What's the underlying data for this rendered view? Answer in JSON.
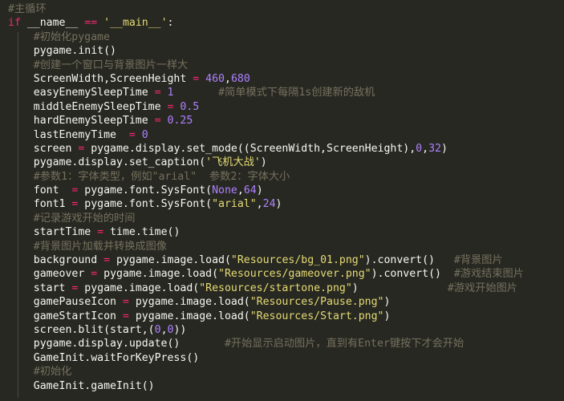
{
  "theme": {
    "background": "#272822",
    "foreground": "#f8f8f2",
    "keyword": "#f92672",
    "string": "#e6db74",
    "number": "#ae81ff",
    "comment": "#75715e",
    "indent_guide": "#4a4b45"
  },
  "editor": {
    "lines": [
      {
        "indent": "",
        "tokens": [
          {
            "t": "cm",
            "v": "#主循环"
          }
        ]
      },
      {
        "indent": "",
        "tokens": [
          {
            "t": "kw",
            "v": "if"
          },
          {
            "t": "plain",
            "v": " __name__ "
          },
          {
            "t": "op",
            "v": "=="
          },
          {
            "t": "plain",
            "v": " "
          },
          {
            "t": "str",
            "v": "'__main__'"
          },
          {
            "t": "plain",
            "v": ":"
          }
        ]
      },
      {
        "indent": "    ",
        "tokens": [
          {
            "t": "cm",
            "v": "#初始化pygame"
          }
        ]
      },
      {
        "indent": "    ",
        "tokens": [
          {
            "t": "plain",
            "v": "pygame.init()"
          }
        ]
      },
      {
        "indent": "    ",
        "tokens": [
          {
            "t": "cm",
            "v": "#创建一个窗口与背景图片一样大"
          }
        ]
      },
      {
        "indent": "    ",
        "tokens": [
          {
            "t": "plain",
            "v": "ScreenWidth,ScreenHeight "
          },
          {
            "t": "op",
            "v": "="
          },
          {
            "t": "plain",
            "v": " "
          },
          {
            "t": "num",
            "v": "460"
          },
          {
            "t": "plain",
            "v": ","
          },
          {
            "t": "num",
            "v": "680"
          }
        ]
      },
      {
        "indent": "    ",
        "tokens": [
          {
            "t": "plain",
            "v": "easyEnemySleepTime "
          },
          {
            "t": "op",
            "v": "="
          },
          {
            "t": "plain",
            "v": " "
          },
          {
            "t": "num",
            "v": "1"
          },
          {
            "t": "plain",
            "v": "       "
          },
          {
            "t": "cm",
            "v": "#简单模式下每隔1s创建新的敌机"
          }
        ]
      },
      {
        "indent": "    ",
        "tokens": [
          {
            "t": "plain",
            "v": "middleEnemySleepTime "
          },
          {
            "t": "op",
            "v": "="
          },
          {
            "t": "plain",
            "v": " "
          },
          {
            "t": "num",
            "v": "0.5"
          }
        ]
      },
      {
        "indent": "    ",
        "tokens": [
          {
            "t": "plain",
            "v": "hardEnemySleepTime "
          },
          {
            "t": "op",
            "v": "="
          },
          {
            "t": "plain",
            "v": " "
          },
          {
            "t": "num",
            "v": "0.25"
          }
        ]
      },
      {
        "indent": "    ",
        "tokens": [
          {
            "t": "plain",
            "v": "lastEnemyTime  "
          },
          {
            "t": "op",
            "v": "="
          },
          {
            "t": "plain",
            "v": " "
          },
          {
            "t": "num",
            "v": "0"
          }
        ]
      },
      {
        "indent": "    ",
        "tokens": [
          {
            "t": "plain",
            "v": "screen "
          },
          {
            "t": "op",
            "v": "="
          },
          {
            "t": "plain",
            "v": " pygame.display.set_mode((ScreenWidth,ScreenHeight),"
          },
          {
            "t": "num",
            "v": "0"
          },
          {
            "t": "plain",
            "v": ","
          },
          {
            "t": "num",
            "v": "32"
          },
          {
            "t": "plain",
            "v": ")"
          }
        ]
      },
      {
        "indent": "    ",
        "tokens": [
          {
            "t": "plain",
            "v": "pygame.display.set_caption("
          },
          {
            "t": "str",
            "v": "'飞机大战'"
          },
          {
            "t": "plain",
            "v": ")"
          }
        ]
      },
      {
        "indent": "    ",
        "tokens": [
          {
            "t": "cm",
            "v": "#参数1：字体类型，例如\"arial\"  参数2：字体大小"
          }
        ]
      },
      {
        "indent": "    ",
        "tokens": [
          {
            "t": "plain",
            "v": "font  "
          },
          {
            "t": "op",
            "v": "="
          },
          {
            "t": "plain",
            "v": " pygame.font.SysFont("
          },
          {
            "t": "num",
            "v": "None"
          },
          {
            "t": "plain",
            "v": ","
          },
          {
            "t": "num",
            "v": "64"
          },
          {
            "t": "plain",
            "v": ")"
          }
        ]
      },
      {
        "indent": "    ",
        "tokens": [
          {
            "t": "plain",
            "v": "font1 "
          },
          {
            "t": "op",
            "v": "="
          },
          {
            "t": "plain",
            "v": " pygame.font.SysFont("
          },
          {
            "t": "str",
            "v": "\"arial\""
          },
          {
            "t": "plain",
            "v": ","
          },
          {
            "t": "num",
            "v": "24"
          },
          {
            "t": "plain",
            "v": ")"
          }
        ]
      },
      {
        "indent": "    ",
        "tokens": [
          {
            "t": "cm",
            "v": "#记录游戏开始的时间"
          }
        ]
      },
      {
        "indent": "    ",
        "tokens": [
          {
            "t": "plain",
            "v": "startTime "
          },
          {
            "t": "op",
            "v": "="
          },
          {
            "t": "plain",
            "v": " time.time()"
          }
        ]
      },
      {
        "indent": "    ",
        "tokens": [
          {
            "t": "cm",
            "v": "#背景图片加载并转换成图像"
          }
        ]
      },
      {
        "indent": "    ",
        "tokens": [
          {
            "t": "plain",
            "v": "background "
          },
          {
            "t": "op",
            "v": "="
          },
          {
            "t": "plain",
            "v": " pygame.image.load("
          },
          {
            "t": "str",
            "v": "\"Resources/bg_01.png\""
          },
          {
            "t": "plain",
            "v": ").convert()   "
          },
          {
            "t": "cm",
            "v": "#背景图片"
          }
        ]
      },
      {
        "indent": "    ",
        "tokens": [
          {
            "t": "plain",
            "v": "gameover "
          },
          {
            "t": "op",
            "v": "="
          },
          {
            "t": "plain",
            "v": " pygame.image.load("
          },
          {
            "t": "str",
            "v": "\"Resources/gameover.png\""
          },
          {
            "t": "plain",
            "v": ").convert()  "
          },
          {
            "t": "cm",
            "v": "#游戏结束图片"
          }
        ]
      },
      {
        "indent": "    ",
        "tokens": [
          {
            "t": "plain",
            "v": "start "
          },
          {
            "t": "op",
            "v": "="
          },
          {
            "t": "plain",
            "v": " pygame.image.load("
          },
          {
            "t": "str",
            "v": "\"Resources/startone.png\""
          },
          {
            "t": "plain",
            "v": ")              "
          },
          {
            "t": "cm",
            "v": "#游戏开始图片"
          }
        ]
      },
      {
        "indent": "    ",
        "tokens": [
          {
            "t": "plain",
            "v": "gamePauseIcon "
          },
          {
            "t": "op",
            "v": "="
          },
          {
            "t": "plain",
            "v": " pygame.image.load("
          },
          {
            "t": "str",
            "v": "\"Resources/Pause.png\""
          },
          {
            "t": "plain",
            "v": ")"
          }
        ]
      },
      {
        "indent": "    ",
        "tokens": [
          {
            "t": "plain",
            "v": "gameStartIcon "
          },
          {
            "t": "op",
            "v": "="
          },
          {
            "t": "plain",
            "v": " pygame.image.load("
          },
          {
            "t": "str",
            "v": "\"Resources/Start.png\""
          },
          {
            "t": "plain",
            "v": ")"
          }
        ]
      },
      {
        "indent": "    ",
        "tokens": [
          {
            "t": "plain",
            "v": "screen.blit(start,("
          },
          {
            "t": "num",
            "v": "0"
          },
          {
            "t": "plain",
            "v": ","
          },
          {
            "t": "num",
            "v": "0"
          },
          {
            "t": "plain",
            "v": "))"
          }
        ]
      },
      {
        "indent": "    ",
        "tokens": [
          {
            "t": "plain",
            "v": "pygame.display.update()       "
          },
          {
            "t": "cm",
            "v": "#开始显示启动图片，直到有Enter键按下才会开始"
          }
        ]
      },
      {
        "indent": "    ",
        "tokens": [
          {
            "t": "plain",
            "v": "GameInit.waitForKeyPress()"
          }
        ]
      },
      {
        "indent": "    ",
        "tokens": [
          {
            "t": "cm",
            "v": "#初始化"
          }
        ]
      },
      {
        "indent": "    ",
        "tokens": [
          {
            "t": "plain",
            "v": "GameInit.gameInit()"
          }
        ]
      }
    ]
  }
}
